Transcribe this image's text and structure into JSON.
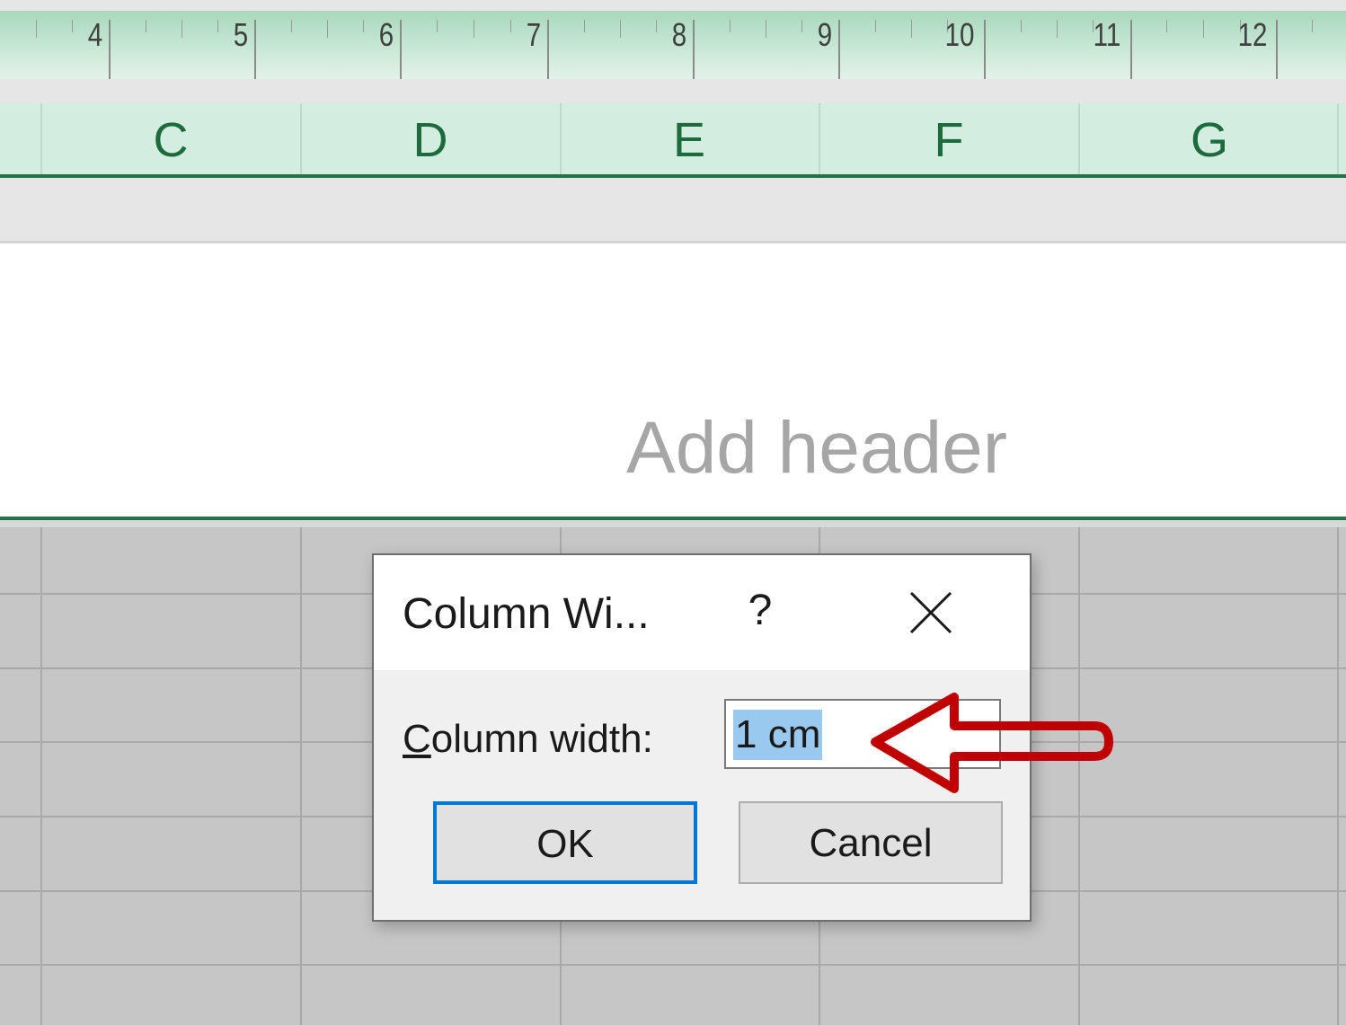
{
  "ruler": {
    "numbers": [
      "4",
      "5",
      "6",
      "7",
      "8",
      "9",
      "10",
      "11",
      "12"
    ]
  },
  "columns": [
    "C",
    "D",
    "E",
    "F",
    "G"
  ],
  "header_area": {
    "placeholder": "Add header"
  },
  "dialog": {
    "title": "Column Wi...",
    "help_label": "?",
    "field_label_mnemonic": "C",
    "field_label_rest": "olumn width:",
    "field_value": "1 cm",
    "ok_label": "OK",
    "cancel_label": "Cancel"
  },
  "colors": {
    "accent_green": "#217346",
    "dialog_focus": "#0078d7",
    "annotation_arrow": "#c00000",
    "selection": "#99c9ef"
  }
}
